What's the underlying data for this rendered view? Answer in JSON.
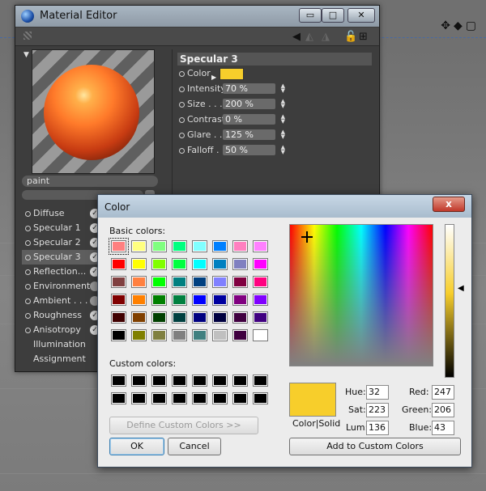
{
  "material_editor": {
    "title": "Material Editor",
    "window_buttons": [
      "▭",
      "□",
      "✕"
    ],
    "material_name": "paint",
    "channels": [
      {
        "label": "Diffuse",
        "enabled": true,
        "active": false
      },
      {
        "label": "Specular 1",
        "enabled": true,
        "active": false
      },
      {
        "label": "Specular 2",
        "enabled": true,
        "active": false
      },
      {
        "label": "Specular 3",
        "enabled": true,
        "active": true
      },
      {
        "label": "Reflection...",
        "enabled": true,
        "active": false
      },
      {
        "label": "Environment",
        "enabled": false,
        "active": false
      },
      {
        "label": "Ambient . . .",
        "enabled": false,
        "active": false
      },
      {
        "label": "Roughness",
        "enabled": true,
        "active": false
      },
      {
        "label": "Anisotropy",
        "enabled": true,
        "active": false
      },
      {
        "label": "Illumination",
        "enabled": null,
        "active": false
      },
      {
        "label": "Assignment",
        "enabled": null,
        "active": false
      }
    ],
    "section_title": "Specular 3",
    "properties": [
      {
        "label": "Color",
        "value": ""
      },
      {
        "label": "Intensity",
        "value": "70 %"
      },
      {
        "label": "Size . . .",
        "value": "200 %"
      },
      {
        "label": "Contrast",
        "value": "0 %"
      },
      {
        "label": "Glare . .",
        "value": "125 %"
      },
      {
        "label": "Falloff . .",
        "value": "50 %"
      }
    ],
    "swatch_color": "#f7ce2b"
  },
  "color_dialog": {
    "title": "Color",
    "close_label": "x",
    "basic_colors_label": "Basic colors:",
    "custom_colors_label": "Custom colors:",
    "define_custom_label": "Define Custom Colors >>",
    "ok_label": "OK",
    "cancel_label": "Cancel",
    "add_custom_label": "Add to Custom Colors",
    "color_solid_label": "Color|Solid",
    "basic_colors": [
      "#ff8080",
      "#ffff80",
      "#80ff80",
      "#00ff80",
      "#80ffff",
      "#0080ff",
      "#ff80c0",
      "#ff80ff",
      "#ff0000",
      "#ffff00",
      "#80ff00",
      "#00ff40",
      "#00ffff",
      "#0080c0",
      "#8080c0",
      "#ff00ff",
      "#804040",
      "#ff8040",
      "#00ff00",
      "#008080",
      "#004080",
      "#8080ff",
      "#800040",
      "#ff0080",
      "#800000",
      "#ff8000",
      "#008000",
      "#008040",
      "#0000ff",
      "#0000a0",
      "#800080",
      "#8000ff",
      "#400000",
      "#804000",
      "#004000",
      "#004040",
      "#000080",
      "#000040",
      "#400040",
      "#400080",
      "#000000",
      "#808000",
      "#808040",
      "#808080",
      "#408080",
      "#c0c0c0",
      "#400040",
      "#ffffff"
    ],
    "hue_label": "Hue:",
    "hue": "32",
    "sat_label": "Sat:",
    "sat": "223",
    "lum_label": "Lum:",
    "lum": "136",
    "red_label": "Red:",
    "red": "247",
    "green_label": "Green:",
    "green": "206",
    "blue_label": "Blue:",
    "blue": "43",
    "selected_color": "#f7ce2b"
  }
}
